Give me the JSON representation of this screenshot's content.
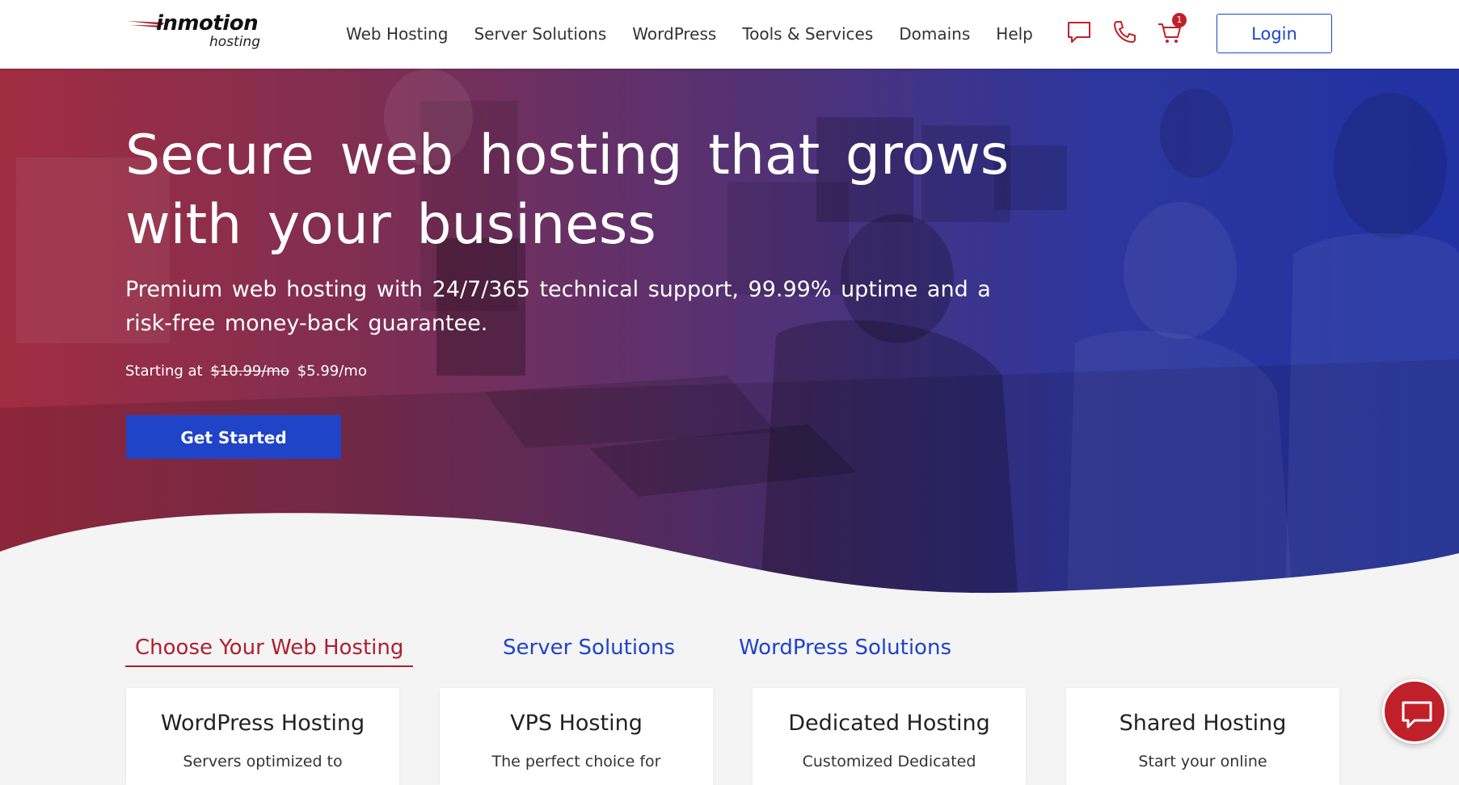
{
  "logo": {
    "main": "inmotion",
    "sub": "hosting"
  },
  "nav": {
    "items": [
      "Web Hosting",
      "Server Solutions",
      "WordPress",
      "Tools & Services",
      "Domains",
      "Help"
    ],
    "icons": [
      "chat-icon",
      "phone-icon",
      "cart-icon"
    ],
    "cart_count": "1",
    "login_label": "Login"
  },
  "hero": {
    "title_line1": "Secure web hosting that grows",
    "title_line2": "with your business",
    "subtitle": "Premium web hosting with 24/7/365 technical support, 99.99% uptime and a risk-free money-back guarantee.",
    "price_prefix": "Starting at",
    "old_price": "$10.99/mo",
    "new_price": "$5.99/mo",
    "cta_label": "Get Started"
  },
  "tabs": [
    {
      "label": "Choose Your Web Hosting",
      "active": true
    },
    {
      "label": "Server Solutions",
      "active": false
    },
    {
      "label": "WordPress Solutions",
      "active": false
    }
  ],
  "cards": [
    {
      "title": "WordPress Hosting",
      "desc": "Servers optimized to"
    },
    {
      "title": "VPS Hosting",
      "desc": "The perfect choice for"
    },
    {
      "title": "Dedicated Hosting",
      "desc": "Customized Dedicated"
    },
    {
      "title": "Shared Hosting",
      "desc": "Start your online"
    }
  ],
  "colors": {
    "brand_blue": "#1f44c8",
    "brand_red": "#b01e2e",
    "chat_red": "#c0202a"
  },
  "chat": {
    "icon": "chat-bubble-icon"
  }
}
